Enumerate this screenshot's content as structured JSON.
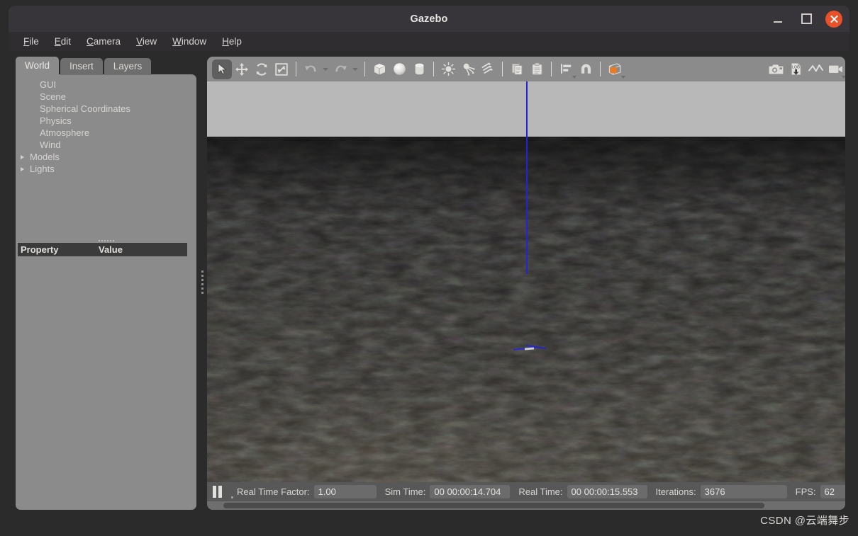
{
  "window": {
    "title": "Gazebo",
    "controls": [
      {
        "name": "minimize",
        "label": "—"
      },
      {
        "name": "maximize",
        "label": "□"
      },
      {
        "name": "close",
        "label": "×"
      }
    ]
  },
  "menubar": {
    "items": [
      {
        "label": "File",
        "mnemonic": "F"
      },
      {
        "label": "Edit",
        "mnemonic": "E"
      },
      {
        "label": "Camera",
        "mnemonic": "C"
      },
      {
        "label": "View",
        "mnemonic": "V"
      },
      {
        "label": "Window",
        "mnemonic": "W"
      },
      {
        "label": "Help",
        "mnemonic": "H"
      }
    ]
  },
  "left_panel": {
    "tabs": [
      {
        "label": "World",
        "active": true
      },
      {
        "label": "Insert",
        "active": false
      },
      {
        "label": "Layers",
        "active": false
      }
    ],
    "tree": [
      {
        "label": "GUI",
        "expandable": false
      },
      {
        "label": "Scene",
        "expandable": false
      },
      {
        "label": "Spherical Coordinates",
        "expandable": false
      },
      {
        "label": "Physics",
        "expandable": false
      },
      {
        "label": "Atmosphere",
        "expandable": false
      },
      {
        "label": "Wind",
        "expandable": false
      },
      {
        "label": "Models",
        "expandable": true
      },
      {
        "label": "Lights",
        "expandable": true
      }
    ],
    "property_table": {
      "columns": [
        "Property",
        "Value"
      ],
      "rows": []
    }
  },
  "toolbar": {
    "items": [
      {
        "name": "select-mode-icon",
        "label": "Selection Mode",
        "active": true
      },
      {
        "name": "translate-mode-icon",
        "label": "Translation Mode",
        "active": false
      },
      {
        "name": "rotate-mode-icon",
        "label": "Rotation Mode",
        "active": false
      },
      {
        "name": "scale-mode-icon",
        "label": "Scale Mode",
        "active": false
      },
      {
        "name": "undo-icon",
        "label": "Undo",
        "active": false
      },
      {
        "name": "redo-icon",
        "label": "Redo",
        "active": false
      },
      {
        "name": "box-icon",
        "label": "Box",
        "active": false
      },
      {
        "name": "sphere-icon",
        "label": "Sphere",
        "active": false
      },
      {
        "name": "cylinder-icon",
        "label": "Cylinder",
        "active": false
      },
      {
        "name": "point-light-icon",
        "label": "Point Light",
        "active": false
      },
      {
        "name": "spot-light-icon",
        "label": "Spot Light",
        "active": false
      },
      {
        "name": "directional-light-icon",
        "label": "Directional Light",
        "active": false
      },
      {
        "name": "copy-icon",
        "label": "Copy",
        "active": false
      },
      {
        "name": "paste-icon",
        "label": "Paste",
        "active": false
      },
      {
        "name": "align-icon",
        "label": "Align",
        "active": false
      },
      {
        "name": "snap-icon",
        "label": "Snap",
        "active": false
      },
      {
        "name": "view-angle-icon",
        "label": "Change View Angle",
        "active": false
      },
      {
        "name": "screenshot-icon",
        "label": "Screenshot",
        "active": false
      },
      {
        "name": "log-icon",
        "label": "Log Data",
        "active": false
      },
      {
        "name": "plot-icon",
        "label": "Plot",
        "active": false
      },
      {
        "name": "record-video-icon",
        "label": "Record Video",
        "active": false
      }
    ],
    "log_glyph": "LOG"
  },
  "viewport": {
    "sky_color": "#b8b8b8",
    "ground_color": "#2b2a27",
    "axis_color": "#2323d8",
    "origin_marker_color": "#cfcfcf"
  },
  "statusbar": {
    "play_state": "paused",
    "fields": [
      {
        "name": "real-time-factor",
        "label": "Real Time Factor:",
        "value": "1.00"
      },
      {
        "name": "sim-time",
        "label": "Sim Time:",
        "value": "00 00:00:14.704"
      },
      {
        "name": "real-time",
        "label": "Real Time:",
        "value": "00 00:00:15.553"
      },
      {
        "name": "iterations",
        "label": "Iterations:",
        "value": "3676"
      },
      {
        "name": "fps",
        "label": "FPS:",
        "value": "62"
      }
    ]
  },
  "watermark": {
    "text": "CSDN @云端舞步"
  }
}
